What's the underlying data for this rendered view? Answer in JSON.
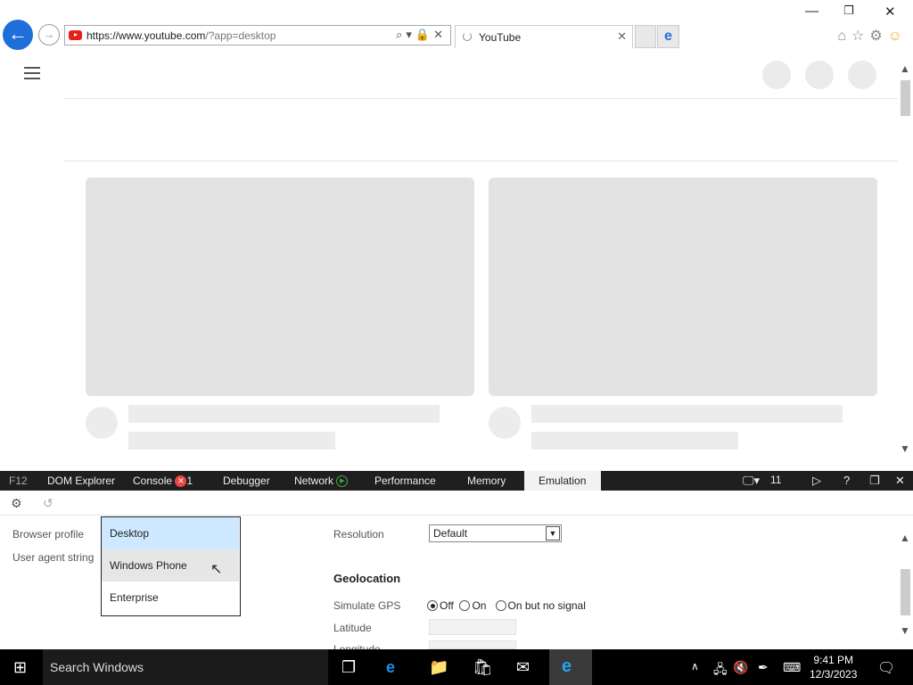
{
  "browser": {
    "url_host": "https://www.youtube.com",
    "url_path": "/?app=desktop",
    "tab_title": "YouTube"
  },
  "devtools": {
    "f12_label": "F12",
    "tabs": [
      "DOM Explorer",
      "Console",
      "Debugger",
      "Network",
      "Performance",
      "Memory",
      "Emulation"
    ],
    "console_error_count": "1",
    "document_mode": "11",
    "browser_profile_label": "Browser profile",
    "user_agent_label": "User agent string",
    "profile_options": [
      "Desktop",
      "Windows Phone",
      "Enterprise"
    ],
    "resolution_label": "Resolution",
    "resolution_value": "Default",
    "geolocation_header": "Geolocation",
    "simulate_gps_label": "Simulate GPS",
    "gps_options": [
      "Off",
      "On",
      "On but no signal"
    ],
    "latitude_label": "Latitude",
    "longitude_label": "Longitude"
  },
  "taskbar": {
    "search_placeholder": "Search Windows",
    "time": "9:41 PM",
    "date": "12/3/2023"
  },
  "colors": {
    "accent": "#1e6fd9",
    "devtools_bar": "#1f1f1f",
    "selected_option": "#cde8ff"
  }
}
